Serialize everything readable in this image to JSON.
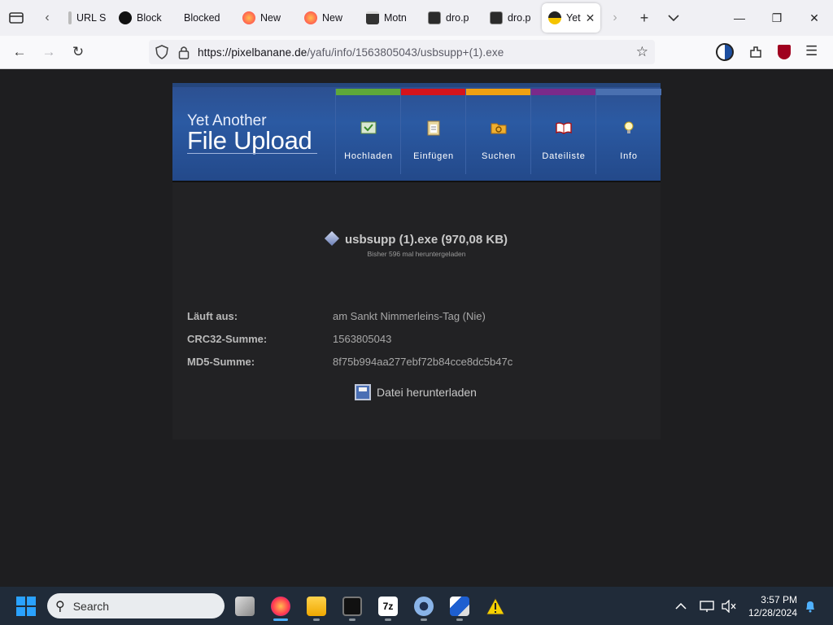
{
  "browser": {
    "tabs": [
      {
        "label": "URL S",
        "color": "#8a8a8a"
      },
      {
        "label": "Block",
        "color": "#111111"
      },
      {
        "label": "Blocked",
        "color": "#f0f0f4"
      },
      {
        "label": "New",
        "color": "#ff7139"
      },
      {
        "label": "New",
        "color": "#ff7139"
      },
      {
        "label": "Motn",
        "color": "#333333"
      },
      {
        "label": "dro.p",
        "color": "#2b2b2b"
      },
      {
        "label": "dro.p",
        "color": "#2b2b2b"
      },
      {
        "label": "Yet",
        "color": "#f5c400"
      }
    ],
    "url_host": "https://pixelbanane.de",
    "url_path": "/yafu/info/1563805043/usbsupp+(1).exe"
  },
  "site": {
    "logo_line1": "Yet Another",
    "logo_line2": "File Upload",
    "menu": [
      {
        "label": "Hochladen",
        "color": "#5ea83a",
        "icon": "upload-icon"
      },
      {
        "label": "Einfügen",
        "color": "#d4141c",
        "icon": "clipboard-icon"
      },
      {
        "label": "Suchen",
        "color": "#f0a010",
        "icon": "search-folder-icon"
      },
      {
        "label": "Dateiliste",
        "color": "#7a2a8a",
        "icon": "book-icon"
      },
      {
        "label": "Info",
        "color": "#4a70b0",
        "icon": "lightbulb-icon"
      }
    ]
  },
  "file": {
    "title": "usbsupp (1).exe (970,08 KB)",
    "downloads": "Bisher 596 mal heruntergeladen",
    "rows": [
      {
        "key": "Läuft aus:",
        "value": "am Sankt Nimmerleins-Tag (Nie)"
      },
      {
        "key": "CRC32-Summe:",
        "value": "1563805043"
      },
      {
        "key": "MD5-Summe:",
        "value": "8f75b994aa277ebf72b84cce8dc5b47c"
      }
    ],
    "download_label": "Datei herunterladen"
  },
  "taskbar": {
    "search_placeholder": "Search",
    "time": "3:57 PM",
    "date": "12/28/2024"
  }
}
